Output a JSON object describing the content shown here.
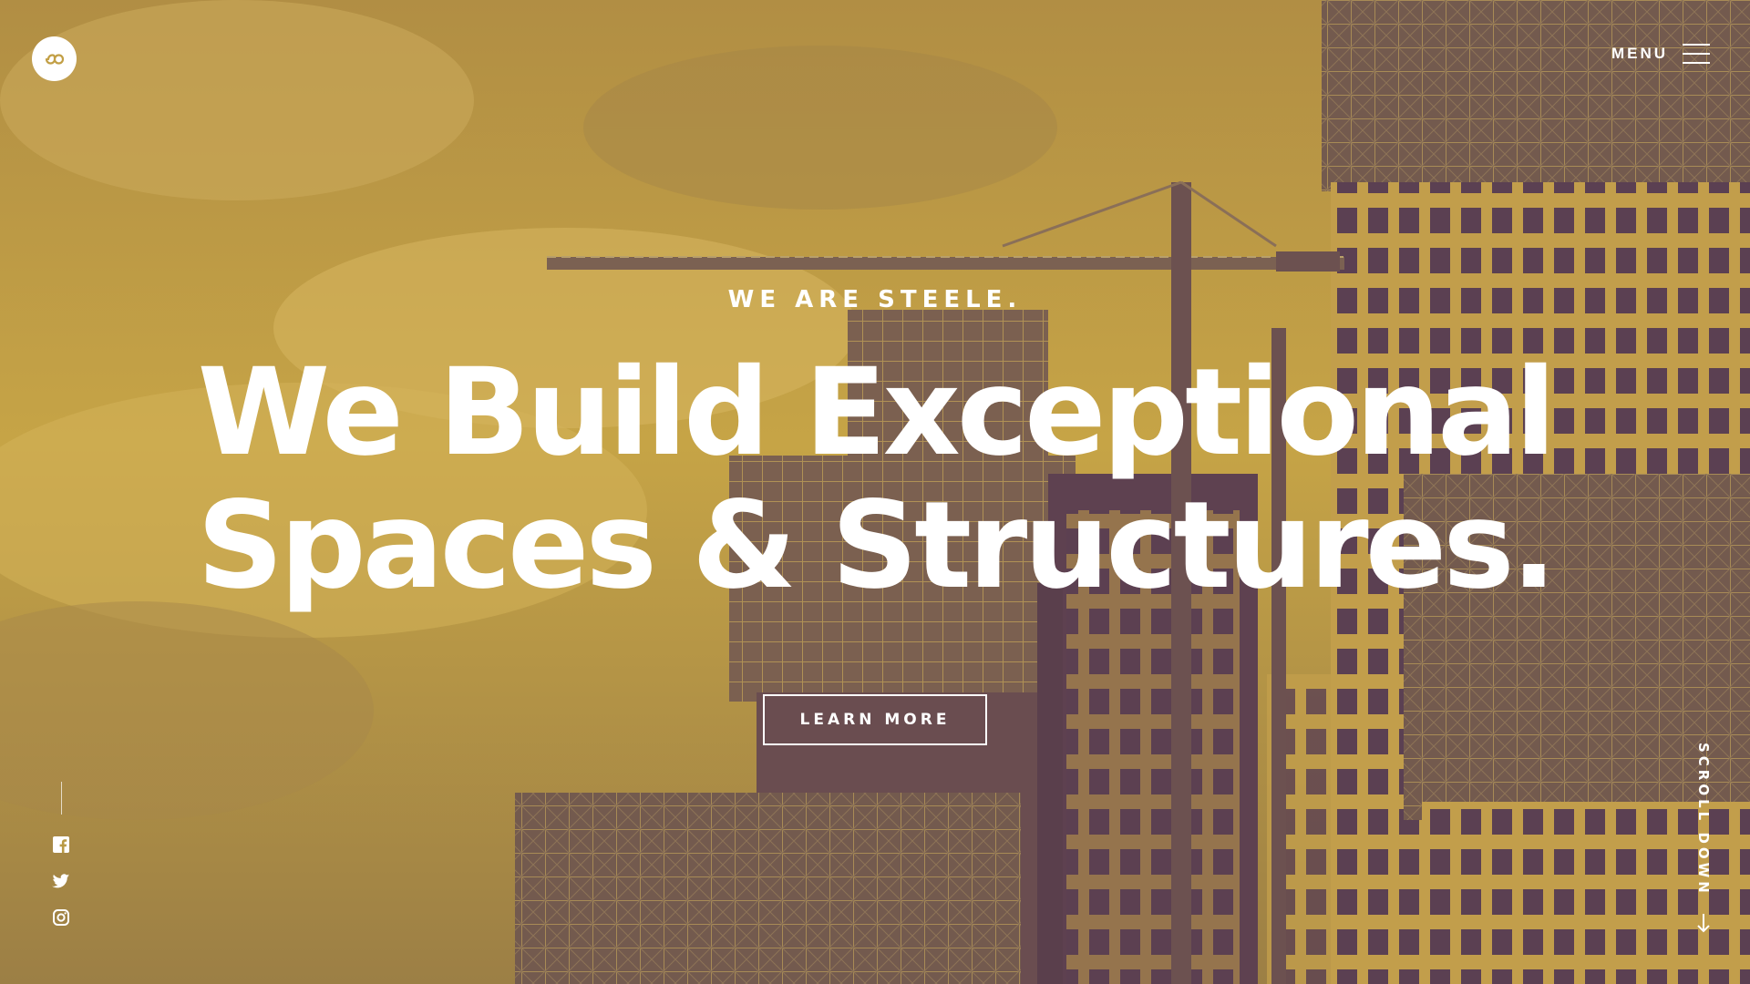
{
  "brand": {
    "logo_icon": "infinity-icon"
  },
  "nav": {
    "menu_label": "MENU",
    "menu_icon": "hamburger-icon"
  },
  "hero": {
    "eyebrow": "WE ARE STEELE.",
    "headline_line1": "We Build Exceptional",
    "headline_line2": "Spaces & Structures.",
    "cta_label": "LEARN MORE",
    "background_scene": "construction-cranes-and-towers",
    "overlay_color": "#c29f45",
    "shadow_color": "#5b3c56"
  },
  "social": {
    "items": [
      {
        "name": "facebook",
        "icon": "facebook-icon"
      },
      {
        "name": "twitter",
        "icon": "twitter-icon"
      },
      {
        "name": "instagram",
        "icon": "instagram-icon"
      }
    ]
  },
  "scroll": {
    "label": "SCROLL DOWN",
    "icon": "arrow-down-icon"
  }
}
